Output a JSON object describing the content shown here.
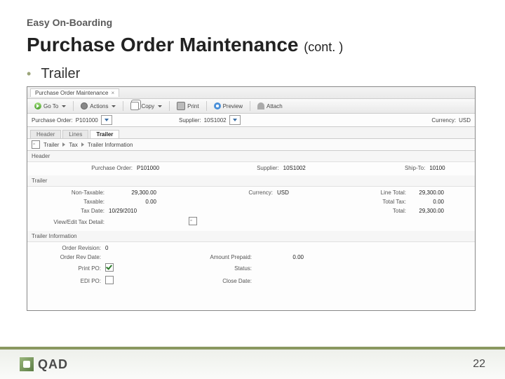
{
  "slide": {
    "kicker": "Easy On-Boarding",
    "title": "Purchase Order Maintenance",
    "title_suffix": "(cont. )",
    "bullet": "Trailer",
    "page_number": "22",
    "logo_text": "QAD"
  },
  "app": {
    "window_tab": "Purchase Order Maintenance",
    "toolbar": {
      "goto": "Go To",
      "actions": "Actions",
      "copy": "Copy",
      "print": "Print",
      "preview": "Preview",
      "attach": "Attach"
    },
    "info": {
      "po_label": "Purchase Order:",
      "po_value": "P101000",
      "supplier_label": "Supplier:",
      "supplier_value": "10S1002",
      "currency_label": "Currency:",
      "currency_value": "USD"
    },
    "subtabs": {
      "header": "Header",
      "lines": "Lines",
      "trailer": "Trailer"
    },
    "crumbs": {
      "trailer": "Trailer",
      "tax": "Tax",
      "trailer_info": "Trailer Information"
    },
    "header_section": {
      "title": "Header",
      "po_label": "Purchase Order:",
      "po_value": "P101000",
      "supplier_label": "Supplier:",
      "supplier_value": "10S1002",
      "shipto_label": "Ship-To:",
      "shipto_value": "10100"
    },
    "trailer_section": {
      "title": "Trailer",
      "nontax_label": "Non-Taxable:",
      "nontax_value": "29,300.00",
      "taxable_label": "Taxable:",
      "taxable_value": "0.00",
      "currency_label": "Currency:",
      "currency_value": "USD",
      "line_total_label": "Line Total:",
      "line_total_value": "29,300.00",
      "total_tax_label": "Total Tax:",
      "total_tax_value": "0.00",
      "taxdate_label": "Tax Date:",
      "taxdate_value": "10/29/2010",
      "total_label": "Total:",
      "total_value": "29,300.00",
      "viewedit_label": "View/Edit Tax Detail:"
    },
    "trailer_info_section": {
      "title": "Trailer Information",
      "order_rev_label": "Order Revision:",
      "order_rev_value": "0",
      "order_rev_date_label": "Order Rev Date:",
      "amount_prepaid_label": "Amount Prepaid:",
      "amount_prepaid_value": "0.00",
      "print_po_label": "Print PO:",
      "status_label": "Status:",
      "edi_po_label": "EDI PO:",
      "close_date_label": "Close Date:"
    }
  }
}
